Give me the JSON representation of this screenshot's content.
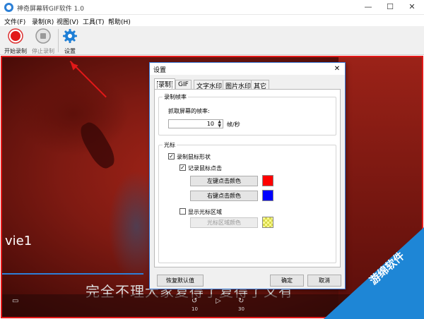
{
  "app": {
    "title": "神奇屏幕转GIF软件 1.0"
  },
  "window_controls": {
    "minimize": "—",
    "maximize": "☐",
    "close": "✕"
  },
  "menu": [
    "文件(F)",
    "录制(R)",
    "视图(V)",
    "工具(T)",
    "帮助(H)"
  ],
  "toolbar": {
    "start_record": "开始录制",
    "stop_record": "停止录制",
    "settings": "设置"
  },
  "capture": {
    "overlay_text": "vie1",
    "subtitle": "完全不理大家复得了复得了又有",
    "player_numbers": [
      "10",
      "30"
    ]
  },
  "dialog": {
    "title": "设置",
    "close": "✕",
    "tabs": [
      "录制",
      "GIF",
      "文字水印",
      "图片水印",
      "其它"
    ],
    "frame_group": {
      "legend": "录制帧率",
      "label": "抓取屏幕的帧率:",
      "value": "10",
      "unit": "帧/秒"
    },
    "cursor_group": {
      "legend": "光标",
      "record_cursor": {
        "label": "录制鼠标形状",
        "checked": true
      },
      "record_click": {
        "label": "记录鼠标点击",
        "checked": true
      },
      "left_click_color": {
        "label": "左键点击颜色",
        "color": "#ff0000"
      },
      "right_click_color": {
        "label": "右键点击颜色",
        "color": "#0000ff"
      },
      "show_cursor_area": {
        "label": "显示光标区域",
        "checked": false
      },
      "cursor_area_color": {
        "label": "光标区域颜色",
        "color": "#f5f58a"
      }
    },
    "buttons": {
      "reset": "恢复默认值",
      "ok": "确定",
      "cancel": "取消"
    }
  },
  "watermark": {
    "text": "游绵软件"
  },
  "colors": {
    "record_red": "#e21818",
    "accent_blue": "#1e86d6",
    "dialog_border": "#3a7ad9"
  }
}
